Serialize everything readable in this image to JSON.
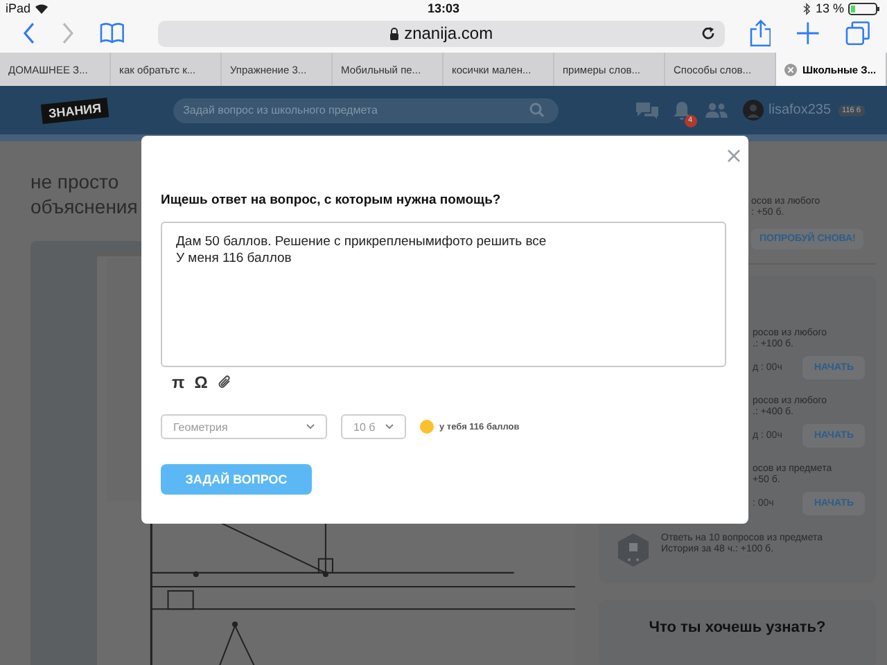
{
  "status_bar": {
    "device": "iPad",
    "time": "13:03",
    "battery": "13 %"
  },
  "browser": {
    "url": "znanija.com",
    "tabs": [
      {
        "label": "ДОМАШНЕЕ З...",
        "selected": false
      },
      {
        "label": "как обратьтс к...",
        "selected": false
      },
      {
        "label": "Упражнение 3...",
        "selected": false
      },
      {
        "label": "Мобильный пе...",
        "selected": false
      },
      {
        "label": "косички мален...",
        "selected": false
      },
      {
        "label": "примеры слов...",
        "selected": false
      },
      {
        "label": "Способы слов...",
        "selected": false
      },
      {
        "label": "Школьные З...",
        "selected": true
      }
    ]
  },
  "site_header": {
    "logo": "ЗНАНИЯ",
    "search_placeholder": "Задай вопрос из школьного предмета",
    "notification_count": "4",
    "username": "lisafox235",
    "points": "116 б"
  },
  "article": {
    "lines": [
      "не просто",
      "объяснения"
    ]
  },
  "sidebar": {
    "top_challenge": {
      "lines": [
        "осов из любого",
        ": +50 б."
      ],
      "button": "ПОПРОБУЙ СНОВА!"
    },
    "challenges": [
      {
        "lines": [
          "росов из любого",
          ".: +100 б."
        ],
        "timer": "д : 00ч",
        "button": "НАЧАТЬ"
      },
      {
        "lines": [
          "росов из любого",
          ".: +400 б."
        ],
        "timer": "д : 00ч",
        "button": "НАЧАТЬ"
      },
      {
        "lines": [
          "осов из предмета",
          "+50 б."
        ],
        "timer": ": 00ч",
        "button": "НАЧАТЬ"
      }
    ],
    "last_challenge": {
      "lines": [
        "Ответь на 10 вопросов из предмета",
        "История за 48 ч.: +100 б."
      ]
    },
    "ask_title": "Что ты хочешь узнать?"
  },
  "modal": {
    "title": "Ищешь ответ на вопрос, с которым нужна помощь?",
    "question": "Дам 50 баллов. Решение с прикрепленымифото решить все\nУ меня 116 баллов",
    "editor_tools": [
      "π",
      "Ω"
    ],
    "subject": "Геометрия",
    "points": "10 б",
    "balance": "у тебя 116 баллов",
    "submit": "ЗАДАЙ ВОПРОС"
  }
}
